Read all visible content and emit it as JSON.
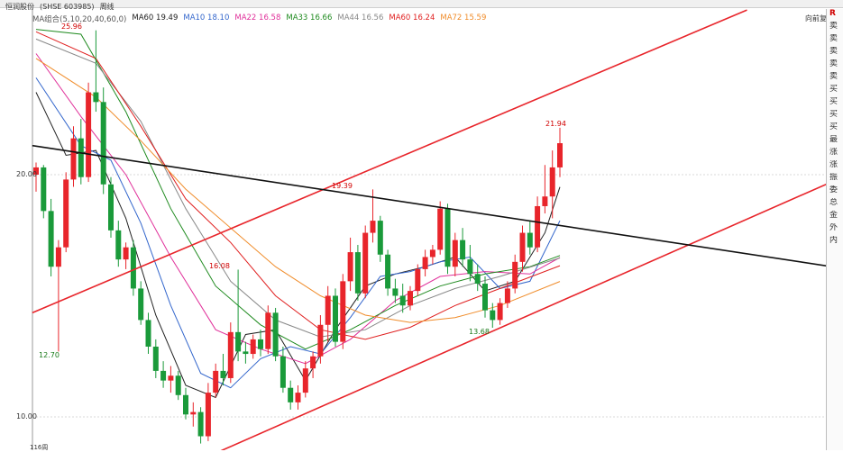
{
  "header": {
    "stock_label": "恒润股份",
    "stock_code": "(SHSE 603985)",
    "period": "周线"
  },
  "ma_legend": {
    "title": "MA组合(5,10,20,40,60,0)",
    "items": [
      {
        "label": "MA60 19.49",
        "color": "#222222"
      },
      {
        "label": "MA10 18.10",
        "color": "#3366cc"
      },
      {
        "label": "MA22 16.58",
        "color": "#e0309a"
      },
      {
        "label": "MA33 16.66",
        "color": "#1e8a1e"
      },
      {
        "label": "MA44 16.56",
        "color": "#888888"
      },
      {
        "label": "MA60 16.24",
        "color": "#e02020"
      },
      {
        "label": "MA72 15.59",
        "color": "#f08c2a"
      }
    ]
  },
  "right_link": "向前复权",
  "right_panel": [
    "R",
    "卖",
    "卖",
    "卖",
    "卖",
    "卖",
    "买",
    "买",
    "买",
    "买",
    "最",
    "涨",
    "涨",
    "振",
    "委",
    "总",
    "金",
    "外",
    "内"
  ],
  "price_labels": {
    "y20": "20.00",
    "y10": "10.00"
  },
  "annotations": {
    "high1": "25.96",
    "low1": "12.70",
    "mid1": "16.08",
    "mid2": "19.39",
    "low2": "13.68",
    "high2": "21.94"
  },
  "corner_label": "116周",
  "colors": {
    "up": "#e8252b",
    "down": "#1a9a3a",
    "trend_red": "#e8252b",
    "trend_black": "#111111"
  },
  "chart_data": {
    "type": "candlestick",
    "ylim": [
      8,
      26
    ],
    "y_ticks": [
      10,
      20
    ],
    "candles": [
      [
        20.0,
        20.5,
        19.3,
        20.3
      ],
      [
        20.3,
        20.4,
        18.2,
        18.5
      ],
      [
        18.5,
        19.0,
        15.8,
        16.2
      ],
      [
        16.2,
        17.3,
        12.7,
        17.0
      ],
      [
        17.0,
        20.1,
        16.8,
        19.8
      ],
      [
        19.8,
        22.0,
        19.5,
        21.5
      ],
      [
        21.5,
        22.3,
        19.6,
        19.9
      ],
      [
        19.9,
        23.8,
        19.7,
        23.4
      ],
      [
        23.4,
        25.96,
        22.6,
        23.0
      ],
      [
        23.0,
        23.6,
        19.2,
        19.6
      ],
      [
        19.6,
        19.9,
        17.4,
        17.7
      ],
      [
        17.7,
        18.1,
        16.2,
        16.5
      ],
      [
        16.5,
        17.2,
        16.1,
        17.0
      ],
      [
        17.0,
        17.3,
        15.0,
        15.3
      ],
      [
        15.3,
        15.6,
        13.8,
        14.0
      ],
      [
        14.0,
        14.3,
        12.6,
        12.9
      ],
      [
        12.9,
        13.2,
        11.6,
        11.9
      ],
      [
        11.9,
        12.3,
        11.2,
        11.5
      ],
      [
        11.5,
        12.1,
        11.0,
        11.7
      ],
      [
        11.7,
        11.9,
        10.7,
        10.9
      ],
      [
        10.9,
        11.2,
        9.9,
        10.1
      ],
      [
        10.1,
        10.6,
        9.6,
        10.2
      ],
      [
        10.2,
        10.4,
        8.9,
        9.2
      ],
      [
        9.2,
        11.4,
        9.0,
        11.0
      ],
      [
        11.0,
        12.2,
        10.8,
        11.9
      ],
      [
        11.9,
        12.6,
        11.3,
        11.6
      ],
      [
        11.6,
        13.9,
        11.4,
        13.5
      ],
      [
        13.5,
        16.08,
        12.3,
        12.7
      ],
      [
        12.7,
        13.1,
        12.2,
        12.6
      ],
      [
        12.6,
        13.4,
        12.4,
        13.2
      ],
      [
        13.2,
        13.6,
        12.5,
        12.8
      ],
      [
        12.8,
        14.6,
        12.6,
        14.3
      ],
      [
        14.3,
        14.5,
        12.3,
        12.5
      ],
      [
        12.5,
        12.9,
        11.0,
        11.2
      ],
      [
        11.2,
        11.5,
        10.3,
        10.6
      ],
      [
        10.6,
        11.3,
        10.3,
        11.0
      ],
      [
        11.0,
        12.3,
        10.8,
        12.0
      ],
      [
        12.0,
        12.7,
        11.6,
        12.5
      ],
      [
        12.5,
        14.2,
        12.2,
        13.8
      ],
      [
        13.8,
        15.4,
        13.1,
        15.0
      ],
      [
        15.0,
        15.3,
        12.9,
        13.1
      ],
      [
        13.1,
        15.9,
        12.8,
        15.6
      ],
      [
        15.6,
        17.4,
        15.2,
        16.8
      ],
      [
        16.8,
        17.1,
        14.8,
        15.1
      ],
      [
        15.1,
        17.9,
        14.9,
        17.6
      ],
      [
        17.6,
        19.39,
        17.2,
        18.1
      ],
      [
        18.1,
        18.3,
        16.4,
        16.7
      ],
      [
        16.7,
        16.9,
        15.0,
        15.3
      ],
      [
        15.3,
        15.7,
        14.7,
        15.0
      ],
      [
        15.0,
        15.5,
        14.3,
        14.6
      ],
      [
        14.6,
        15.4,
        14.4,
        15.2
      ],
      [
        15.2,
        16.3,
        15.0,
        16.1
      ],
      [
        16.1,
        16.9,
        15.8,
        16.6
      ],
      [
        16.6,
        17.1,
        16.3,
        16.9
      ],
      [
        16.9,
        18.9,
        16.7,
        18.6
      ],
      [
        18.6,
        18.8,
        15.9,
        16.2
      ],
      [
        16.2,
        17.6,
        15.8,
        17.3
      ],
      [
        17.3,
        17.8,
        16.2,
        16.5
      ],
      [
        16.5,
        17.1,
        15.6,
        15.9
      ],
      [
        15.9,
        16.3,
        15.2,
        15.5
      ],
      [
        15.5,
        15.8,
        14.1,
        14.4
      ],
      [
        14.4,
        14.7,
        13.68,
        14.0
      ],
      [
        14.0,
        14.9,
        13.8,
        14.7
      ],
      [
        14.7,
        15.6,
        14.5,
        15.3
      ],
      [
        15.3,
        16.7,
        15.1,
        16.4
      ],
      [
        16.4,
        17.9,
        16.0,
        17.6
      ],
      [
        17.6,
        18.1,
        16.7,
        17.0
      ],
      [
        17.0,
        19.1,
        16.8,
        18.7
      ],
      [
        18.7,
        20.4,
        18.4,
        19.1
      ],
      [
        19.1,
        21.0,
        18.2,
        20.3
      ],
      [
        20.3,
        21.94,
        19.9,
        21.3
      ]
    ],
    "ma_lines": [
      {
        "name": "MA60",
        "color": "#222222",
        "points": [
          [
            0,
            23.4
          ],
          [
            4,
            20.8
          ],
          [
            8,
            21.0
          ],
          [
            12,
            18.2
          ],
          [
            16,
            14.2
          ],
          [
            20,
            11.3
          ],
          [
            24,
            10.8
          ],
          [
            28,
            13.4
          ],
          [
            32,
            13.6
          ],
          [
            36,
            11.5
          ],
          [
            40,
            13.6
          ],
          [
            44,
            15.4
          ],
          [
            48,
            15.9
          ],
          [
            52,
            16.2
          ],
          [
            56,
            16.6
          ],
          [
            60,
            15.2
          ],
          [
            64,
            15.6
          ],
          [
            68,
            17.6
          ],
          [
            70,
            19.49
          ]
        ]
      },
      {
        "name": "MA10",
        "color": "#3366cc",
        "points": [
          [
            0,
            24.0
          ],
          [
            6,
            21.2
          ],
          [
            10,
            20.6
          ],
          [
            14,
            18.0
          ],
          [
            18,
            14.6
          ],
          [
            22,
            11.8
          ],
          [
            26,
            11.2
          ],
          [
            30,
            12.4
          ],
          [
            34,
            12.9
          ],
          [
            38,
            12.6
          ],
          [
            42,
            14.1
          ],
          [
            46,
            15.8
          ],
          [
            50,
            16.0
          ],
          [
            54,
            16.4
          ],
          [
            58,
            16.6
          ],
          [
            62,
            15.3
          ],
          [
            66,
            15.6
          ],
          [
            70,
            18.1
          ]
        ]
      },
      {
        "name": "MA22",
        "color": "#e0309a",
        "points": [
          [
            0,
            25.0
          ],
          [
            6,
            22.4
          ],
          [
            12,
            20.0
          ],
          [
            18,
            16.6
          ],
          [
            24,
            13.6
          ],
          [
            30,
            12.8
          ],
          [
            36,
            12.2
          ],
          [
            42,
            13.2
          ],
          [
            48,
            14.8
          ],
          [
            54,
            15.8
          ],
          [
            60,
            16.0
          ],
          [
            66,
            15.9
          ],
          [
            70,
            16.58
          ]
        ]
      },
      {
        "name": "MA33",
        "color": "#1e8a1e",
        "points": [
          [
            0,
            26.0
          ],
          [
            6,
            25.8
          ],
          [
            12,
            22.6
          ],
          [
            18,
            18.6
          ],
          [
            24,
            15.4
          ],
          [
            30,
            13.8
          ],
          [
            36,
            12.8
          ],
          [
            42,
            13.6
          ],
          [
            48,
            14.6
          ],
          [
            54,
            15.4
          ],
          [
            60,
            15.9
          ],
          [
            66,
            16.2
          ],
          [
            70,
            16.66
          ]
        ]
      },
      {
        "name": "MA44",
        "color": "#888888",
        "points": [
          [
            0,
            25.6
          ],
          [
            8,
            24.6
          ],
          [
            14,
            22.2
          ],
          [
            20,
            18.6
          ],
          [
            26,
            15.6
          ],
          [
            32,
            14.0
          ],
          [
            38,
            13.3
          ],
          [
            44,
            13.6
          ],
          [
            50,
            14.6
          ],
          [
            56,
            15.3
          ],
          [
            62,
            15.8
          ],
          [
            70,
            16.56
          ]
        ]
      },
      {
        "name": "MA60",
        "color": "#e02020",
        "points": [
          [
            0,
            25.9
          ],
          [
            8,
            24.8
          ],
          [
            14,
            22.0
          ],
          [
            20,
            19.0
          ],
          [
            26,
            17.2
          ],
          [
            32,
            15.0
          ],
          [
            38,
            13.6
          ],
          [
            44,
            13.2
          ],
          [
            50,
            13.7
          ],
          [
            56,
            14.6
          ],
          [
            62,
            15.3
          ],
          [
            70,
            16.24
          ]
        ]
      },
      {
        "name": "MA72",
        "color": "#f08c2a",
        "points": [
          [
            0,
            24.8
          ],
          [
            8,
            23.2
          ],
          [
            14,
            21.4
          ],
          [
            20,
            19.4
          ],
          [
            26,
            17.8
          ],
          [
            32,
            16.2
          ],
          [
            38,
            15.0
          ],
          [
            44,
            14.2
          ],
          [
            50,
            13.9
          ],
          [
            56,
            14.1
          ],
          [
            62,
            14.6
          ],
          [
            70,
            15.59
          ]
        ]
      }
    ],
    "trend_lines": [
      {
        "color": "#e8252b",
        "from": [
          -0.5,
          14.3
        ],
        "to": [
          95.0,
          26.8
        ]
      },
      {
        "color": "#e8252b",
        "from": [
          20.3,
          8.0
        ],
        "to": [
          108.5,
          20.0
        ]
      },
      {
        "color": "#111111",
        "from": [
          -0.5,
          21.2
        ],
        "to": [
          108.5,
          16.1
        ]
      }
    ]
  }
}
